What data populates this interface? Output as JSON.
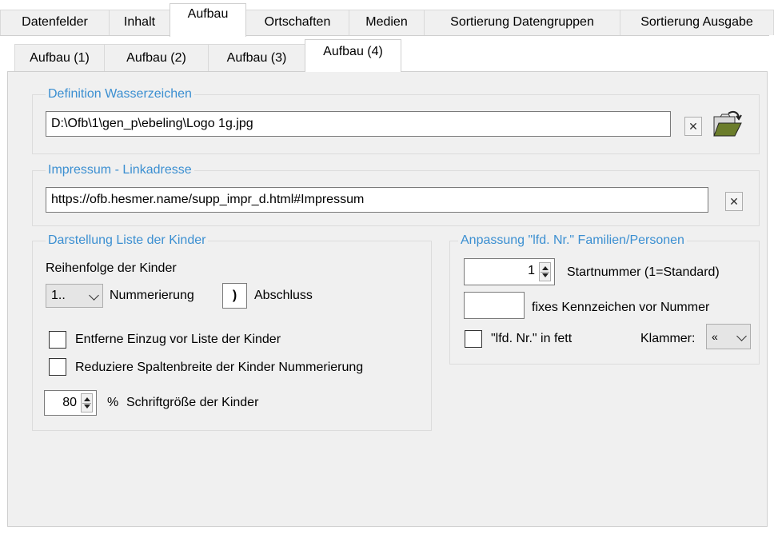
{
  "main_tabs": [
    {
      "label": "Datenfelder"
    },
    {
      "label": "Inhalt"
    },
    {
      "label": "Aufbau"
    },
    {
      "label": "Ortschaften"
    },
    {
      "label": "Medien"
    },
    {
      "label": "Sortierung Datengruppen"
    },
    {
      "label": "Sortierung Ausgabe"
    }
  ],
  "main_active_tab": "Aufbau",
  "sub_tabs": [
    {
      "label": "Aufbau (1)"
    },
    {
      "label": "Aufbau (2)"
    },
    {
      "label": "Aufbau (3)"
    },
    {
      "label": "Aufbau (4)"
    }
  ],
  "sub_active_tab": "Aufbau (4)",
  "watermark": {
    "legend": "Definition Wasserzeichen",
    "path_value": "D:\\Ofb\\1\\gen_p\\ebeling\\Logo 1g.jpg",
    "clear_glyph": "✕",
    "open_icon": "folder-open-icon"
  },
  "impressum": {
    "legend": "Impressum - Linkadresse",
    "url_value": "https://ofb.hesmer.name/supp_impr_d.html#Impressum",
    "clear_glyph": "✕"
  },
  "children_list": {
    "legend": "Darstellung Liste der Kinder",
    "order_label": "Reihenfolge der Kinder",
    "numbering_value": "1..",
    "numbering_label": "Nummerierung",
    "closing_char": ")",
    "closing_label": "Abschluss",
    "option_remove_indent": {
      "label": "Entferne Einzug vor Liste der Kinder",
      "checked": false
    },
    "option_reduce_width": {
      "label": "Reduziere Spaltenbreite der Kinder Nummerierung",
      "checked": false
    },
    "font_size_value": "80",
    "font_size_unit": "%",
    "font_size_label": "Schriftgröße der Kinder"
  },
  "numbering_adjust": {
    "legend": "Anpassung \"lfd. Nr.\" Familien/Personen",
    "start_value": "1",
    "start_label": "Startnummer (1=Standard)",
    "prefix_value": "",
    "prefix_label": "fixes Kennzeichen vor Nummer",
    "bold_label": "\"lfd. Nr.\" in fett",
    "bold_checked": false,
    "bracket_label": "Klammer:",
    "bracket_value": "«"
  }
}
